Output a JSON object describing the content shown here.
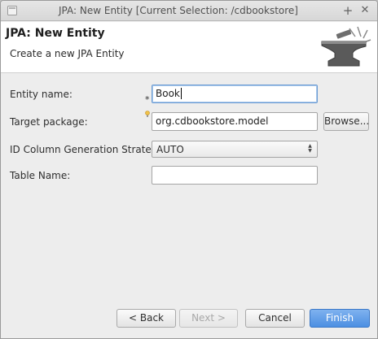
{
  "window": {
    "title": "JPA: New Entity [Current Selection: /cdbookstore]",
    "maximize_glyph": "+",
    "close_glyph": "✕"
  },
  "banner": {
    "title": "JPA: New Entity",
    "description": "Create a new JPA Entity",
    "icon": "anvil-icon"
  },
  "form": {
    "entity_name": {
      "label": "Entity name:",
      "value": "Book",
      "required_marker": "*"
    },
    "target_package": {
      "label": "Target package:",
      "value": "org.cdbookstore.model"
    },
    "id_strategy": {
      "label": "ID Column Generation Strategy:",
      "value": "AUTO"
    },
    "table_name": {
      "label": "Table Name:",
      "value": ""
    },
    "browse_label": "Browse..."
  },
  "buttons": {
    "back": "< Back",
    "next": "Next >",
    "cancel": "Cancel",
    "finish": "Finish"
  },
  "colors": {
    "primary_button": "#4c8fe2",
    "background": "#ededed",
    "banner": "#ffffff"
  }
}
